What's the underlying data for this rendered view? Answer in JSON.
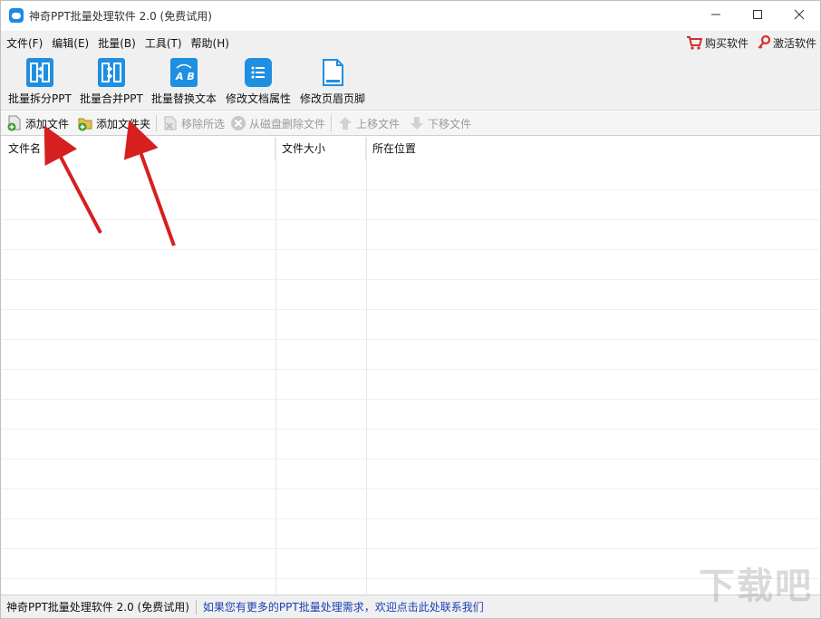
{
  "window": {
    "title": "神奇PPT批量处理软件 2.0 (免费试用)",
    "controls": [
      "─",
      "☐",
      "✕"
    ]
  },
  "menu": {
    "items": [
      "文件(F)",
      "编辑(E)",
      "批量(B)",
      "工具(T)",
      "帮助(H)"
    ],
    "right": [
      {
        "label": "购买软件",
        "icon": "cart-icon",
        "color": "#d32f2f"
      },
      {
        "label": "激活软件",
        "icon": "key-icon",
        "color": "#d32f2f"
      }
    ]
  },
  "big_toolbar": [
    {
      "label": "批量拆分PPT",
      "icon": "split-ppt-icon"
    },
    {
      "label": "批量合并PPT",
      "icon": "merge-ppt-icon"
    },
    {
      "label": "批量替换文本",
      "icon": "replace-text-icon"
    },
    {
      "label": "修改文档属性",
      "icon": "doc-properties-icon"
    },
    {
      "label": "修改页眉页脚",
      "icon": "header-footer-icon"
    }
  ],
  "small_toolbar": [
    {
      "label": "添加文件",
      "icon": "add-file-icon",
      "enabled": true
    },
    {
      "label": "添加文件夹",
      "icon": "add-folder-icon",
      "enabled": true
    },
    {
      "label": "移除所选",
      "icon": "remove-selected-icon",
      "enabled": false
    },
    {
      "label": "从磁盘删除文件",
      "icon": "delete-from-disk-icon",
      "enabled": false
    },
    {
      "label": "上移文件",
      "icon": "move-up-icon",
      "enabled": false
    },
    {
      "label": "下移文件",
      "icon": "move-down-icon",
      "enabled": false
    }
  ],
  "table": {
    "columns": [
      "文件名",
      "文件大小",
      "所在位置"
    ],
    "rows": []
  },
  "status": {
    "app_name": "神奇PPT批量处理软件 2.0 (免费试用)",
    "link": "如果您有更多的PPT批量处理需求，欢迎点击此处联系我们"
  },
  "colors": {
    "accent": "#1e8fe1",
    "link": "#1a3fb4",
    "arrow": "#d62020"
  }
}
